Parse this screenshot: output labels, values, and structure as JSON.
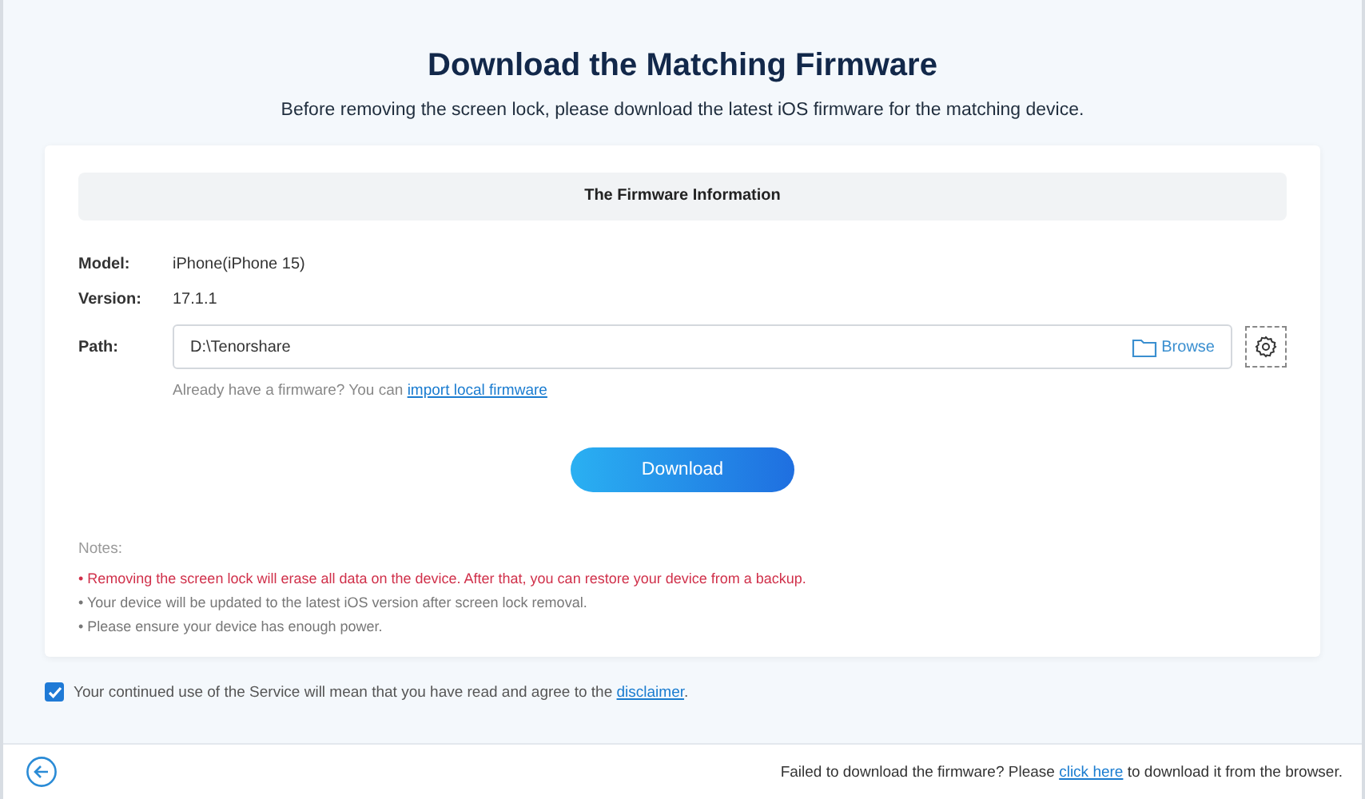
{
  "title": "Download the Matching Firmware",
  "subtitle": "Before removing the screen lock, please download the latest iOS firmware for the matching device.",
  "firmware_info": {
    "heading": "The Firmware Information",
    "fields": [
      {
        "label": "Model:",
        "value": "iPhone(iPhone 15)"
      },
      {
        "label": "Version:",
        "value": "17.1.1"
      }
    ],
    "path": {
      "label": "Path:",
      "value": "D:\\Tenorshare",
      "browse": "Browse"
    },
    "import_hint": {
      "before": "Already have a firmware? You can ",
      "link": "import local firmware"
    }
  },
  "download_button": "Download",
  "notes": {
    "heading": "Notes:",
    "items": [
      {
        "kind": "warning",
        "text": "• Removing the screen lock will erase all data on the device. After that, you can restore your device from a backup."
      },
      {
        "kind": "normal",
        "text": "• Your device will be updated to the latest iOS version after screen lock removal."
      },
      {
        "kind": "normal",
        "text": "• Please ensure your device has enough power."
      }
    ]
  },
  "agreement": {
    "checked": true,
    "before": "Your continued use of the Service will mean that you have read and agree to the ",
    "link": "disclaimer",
    "after": "."
  },
  "footer": {
    "before": "Failed to download the firmware? Please ",
    "link": "click here",
    "after": " to download it from the browser."
  }
}
